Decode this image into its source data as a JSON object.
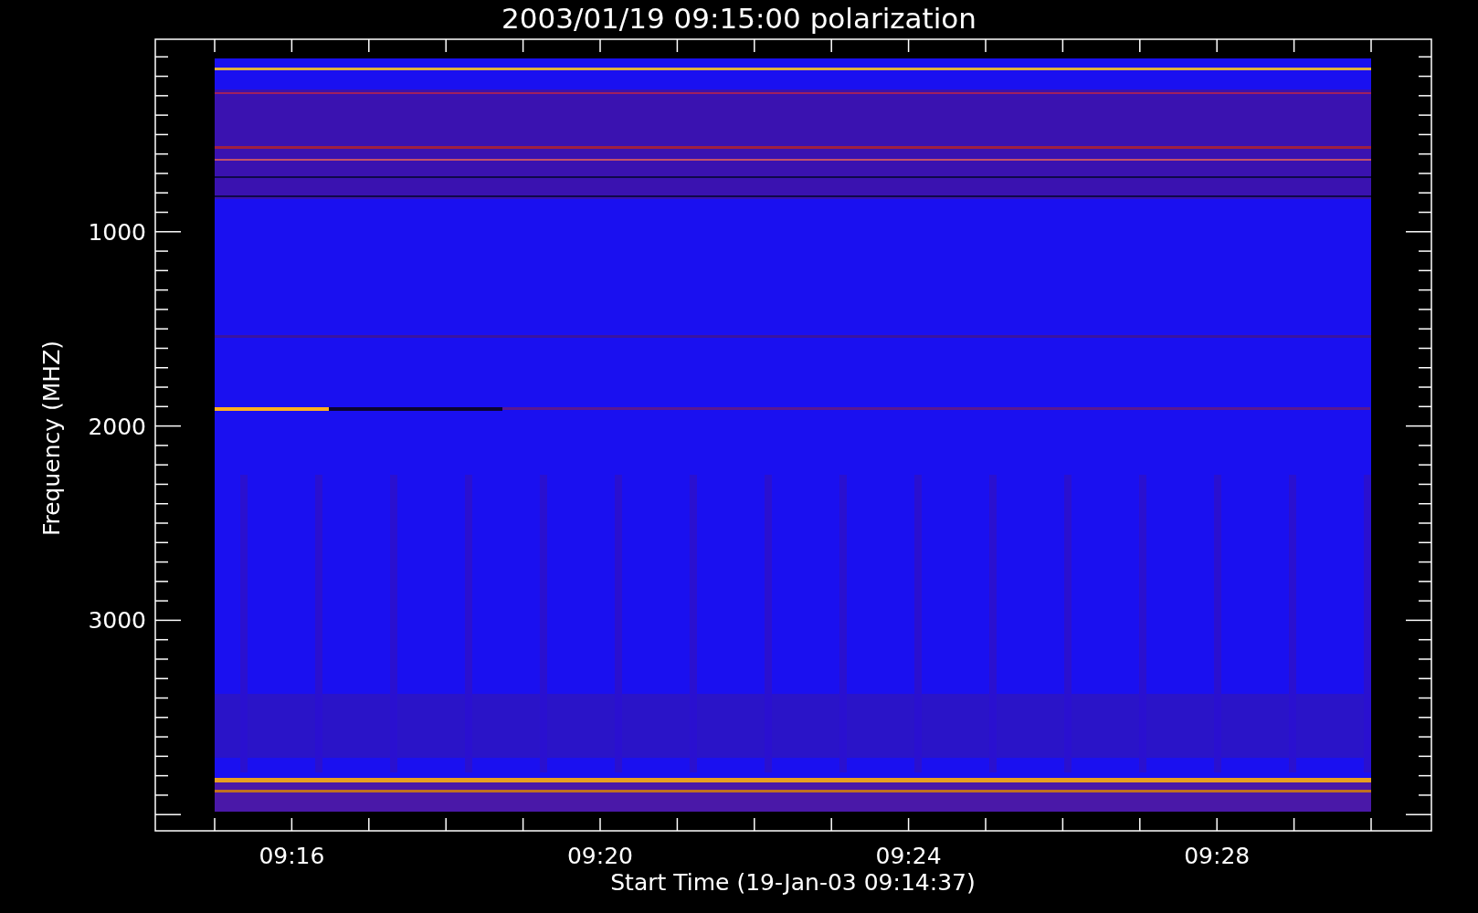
{
  "title": "2003/01/19 09:15:00 polarization",
  "y_axis": {
    "label": "Frequency (MHZ)",
    "ticks": [
      "1000",
      "2000",
      "3000"
    ]
  },
  "x_axis": {
    "label": "Start Time (19-Jan-03 09:14:37)",
    "ticks": [
      "09:16",
      "09:20",
      "09:24",
      "09:28"
    ]
  }
}
